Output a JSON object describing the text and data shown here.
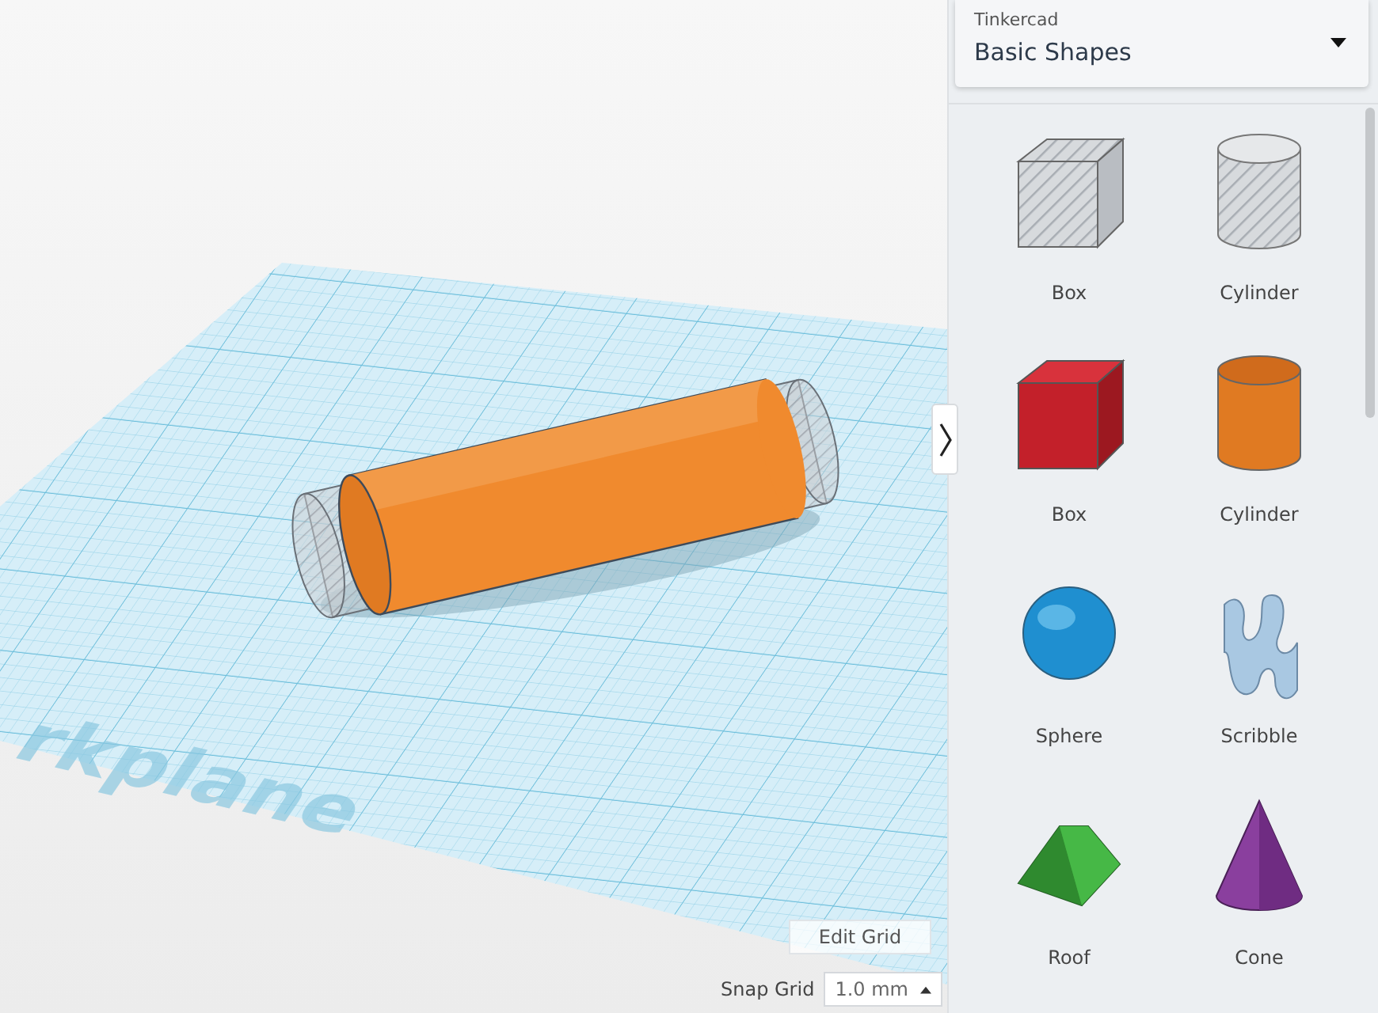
{
  "viewport": {
    "workplane_label": "rkplane",
    "edit_grid": "Edit Grid",
    "snap_grid": {
      "label": "Snap Grid",
      "value": "1.0 mm"
    }
  },
  "library": {
    "label": "Tinkercad",
    "selection": "Basic Shapes"
  },
  "shapes": [
    {
      "name": "Box",
      "kind": "box_hole"
    },
    {
      "name": "Cylinder",
      "kind": "cylinder_hole"
    },
    {
      "name": "Box",
      "kind": "box"
    },
    {
      "name": "Cylinder",
      "kind": "cylinder"
    },
    {
      "name": "Sphere",
      "kind": "sphere"
    },
    {
      "name": "Scribble",
      "kind": "scribble"
    },
    {
      "name": "Roof",
      "kind": "roof"
    },
    {
      "name": "Cone",
      "kind": "cone"
    }
  ]
}
